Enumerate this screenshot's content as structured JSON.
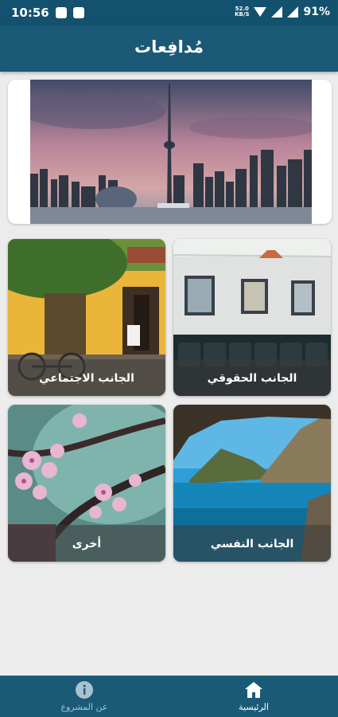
{
  "status_bar": {
    "time": "10:56",
    "net_speed_top": "52.0",
    "net_speed_unit": "KB/S",
    "battery": "91%"
  },
  "app_bar": {
    "title": "مُدافِعات"
  },
  "categories": [
    {
      "label": "الجانب الحقوقي"
    },
    {
      "label": "الجانب الاجتماعي"
    },
    {
      "label": "الجانب النفسي"
    },
    {
      "label": "أخرى"
    }
  ],
  "bottom_nav": {
    "home_label": "الرئيسية",
    "about_label": "عن المشروع"
  },
  "colors": {
    "primary": "#1b5a76",
    "status_bar": "#13516e",
    "background": "#ececec"
  }
}
